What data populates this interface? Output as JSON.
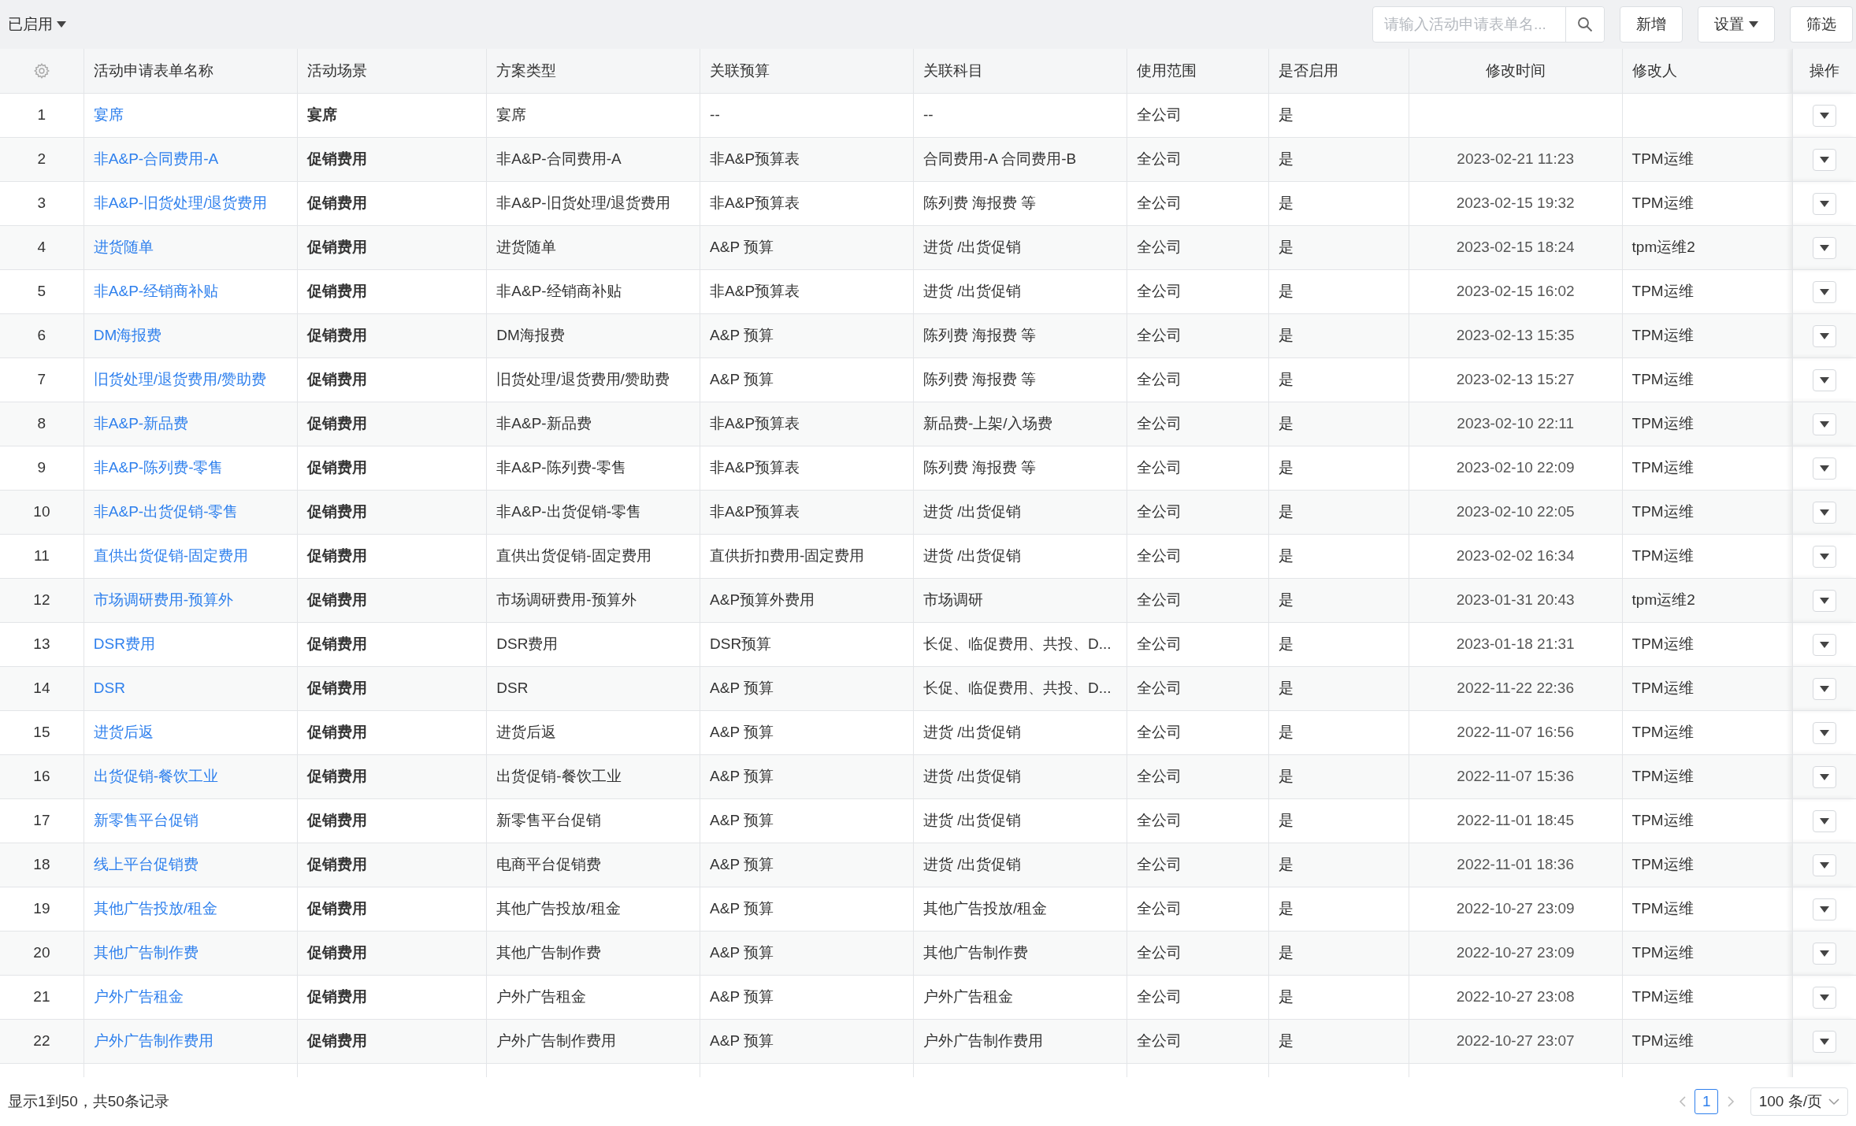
{
  "toolbar": {
    "status_filter": "已启用",
    "search": {
      "placeholder": "请输入活动申请表单名..."
    },
    "buttons": [
      {
        "label": "新增",
        "kind": "plain"
      },
      {
        "label": "设置",
        "kind": "dropdown"
      },
      {
        "label": "筛选",
        "kind": "plain"
      }
    ]
  },
  "table": {
    "columns": [
      "活动申请表单名称",
      "活动场景",
      "方案类型",
      "关联预算",
      "关联科目",
      "使用范围",
      "是否启用",
      "修改时间",
      "修改人",
      "操作"
    ],
    "rows": [
      {
        "index": "1",
        "name": "宴席",
        "scene": "宴席",
        "type": "宴席",
        "budget": "--",
        "subject": "--",
        "scope": "全公司",
        "enabled": "是"
      },
      {
        "index": "2",
        "name": "非A&P-合同费用-A",
        "scene": "促销费用",
        "type": "非A&P-合同费用-A",
        "budget": "非A&P预算表",
        "subject": "合同费用-A 合同费用-B",
        "scope": "全公司",
        "enabled": "是",
        "time": "2023-02-21 11:23",
        "modifier": "TPM运维"
      },
      {
        "index": "3",
        "name": "非A&P-旧货处理/退货费用",
        "scene": "促销费用",
        "type": "非A&P-旧货处理/退货费用",
        "budget": "非A&P预算表",
        "subject": "陈列费 海报费 等",
        "scope": "全公司",
        "enabled": "是",
        "time": "2023-02-15 19:32",
        "modifier": "TPM运维"
      },
      {
        "index": "4",
        "name": "进货随单",
        "scene": "促销费用",
        "type": "进货随单",
        "budget": "A&P 预算",
        "subject": "进货 /出货促销",
        "scope": "全公司",
        "enabled": "是",
        "time": "2023-02-15 18:24",
        "modifier": "tpm运维2"
      },
      {
        "index": "5",
        "name": "非A&P-经销商补贴",
        "scene": "促销费用",
        "type": "非A&P-经销商补贴",
        "budget": "非A&P预算表",
        "subject": "进货 /出货促销",
        "scope": "全公司",
        "enabled": "是",
        "time": "2023-02-15 16:02",
        "modifier": "TPM运维"
      },
      {
        "index": "6",
        "name": "DM海报费",
        "scene": "促销费用",
        "type": "DM海报费",
        "budget": "A&P 预算",
        "subject": "陈列费 海报费 等",
        "scope": "全公司",
        "enabled": "是",
        "time": "2023-02-13 15:35",
        "modifier": "TPM运维"
      },
      {
        "index": "7",
        "name": "旧货处理/退货费用/赞助费",
        "scene": "促销费用",
        "type": "旧货处理/退货费用/赞助费",
        "budget": "A&P 预算",
        "subject": "陈列费 海报费 等",
        "scope": "全公司",
        "enabled": "是",
        "time": "2023-02-13 15:27",
        "modifier": "TPM运维"
      },
      {
        "index": "8",
        "name": "非A&P-新品费",
        "scene": "促销费用",
        "type": "非A&P-新品费",
        "budget": "非A&P预算表",
        "subject": "新品费-上架/入场费",
        "scope": "全公司",
        "enabled": "是",
        "time": "2023-02-10 22:11",
        "modifier": "TPM运维"
      },
      {
        "index": "9",
        "name": "非A&P-陈列费-零售",
        "scene": "促销费用",
        "type": "非A&P-陈列费-零售",
        "budget": "非A&P预算表",
        "subject": "陈列费 海报费 等",
        "scope": "全公司",
        "enabled": "是",
        "time": "2023-02-10 22:09",
        "modifier": "TPM运维"
      },
      {
        "index": "10",
        "name": "非A&P-出货促销-零售",
        "scene": "促销费用",
        "type": "非A&P-出货促销-零售",
        "budget": "非A&P预算表",
        "subject": "进货 /出货促销",
        "scope": "全公司",
        "enabled": "是",
        "time": "2023-02-10 22:05",
        "modifier": "TPM运维"
      },
      {
        "index": "11",
        "name": "直供出货促销-固定费用",
        "scene": "促销费用",
        "type": "直供出货促销-固定费用",
        "budget": "直供折扣费用-固定费用",
        "subject": "进货 /出货促销",
        "scope": "全公司",
        "enabled": "是",
        "time": "2023-02-02 16:34",
        "modifier": "TPM运维"
      },
      {
        "index": "12",
        "name": "市场调研费用-预算外",
        "scene": "促销费用",
        "type": "市场调研费用-预算外",
        "budget": "A&P预算外费用",
        "subject": "市场调研",
        "scope": "全公司",
        "enabled": "是",
        "time": "2023-01-31 20:43",
        "modifier": "tpm运维2"
      },
      {
        "index": "13",
        "name": "DSR费用",
        "scene": "促销费用",
        "type": "DSR费用",
        "budget": "DSR预算",
        "subject": "长促、临促费用、共投、D...",
        "scope": "全公司",
        "enabled": "是",
        "time": "2023-01-18 21:31",
        "modifier": "TPM运维"
      },
      {
        "index": "14",
        "name": "DSR",
        "scene": "促销费用",
        "type": "DSR",
        "budget": "A&P 预算",
        "subject": "长促、临促费用、共投、D...",
        "scope": "全公司",
        "enabled": "是",
        "time": "2022-11-22 22:36",
        "modifier": "TPM运维"
      },
      {
        "index": "15",
        "name": "进货后返",
        "scene": "促销费用",
        "type": "进货后返",
        "budget": "A&P 预算",
        "subject": "进货 /出货促销",
        "scope": "全公司",
        "enabled": "是",
        "time": "2022-11-07 16:56",
        "modifier": "TPM运维"
      },
      {
        "index": "16",
        "name": "出货促销-餐饮工业",
        "scene": "促销费用",
        "type": "出货促销-餐饮工业",
        "budget": "A&P 预算",
        "subject": "进货 /出货促销",
        "scope": "全公司",
        "enabled": "是",
        "time": "2022-11-07 15:36",
        "modifier": "TPM运维"
      },
      {
        "index": "17",
        "name": "新零售平台促销",
        "scene": "促销费用",
        "type": "新零售平台促销",
        "budget": "A&P 预算",
        "subject": "进货 /出货促销",
        "scope": "全公司",
        "enabled": "是",
        "time": "2022-11-01 18:45",
        "modifier": "TPM运维"
      },
      {
        "index": "18",
        "name": "线上平台促销费",
        "scene": "促销费用",
        "type": "电商平台促销费",
        "budget": "A&P 预算",
        "subject": "进货 /出货促销",
        "scope": "全公司",
        "enabled": "是",
        "time": "2022-11-01 18:36",
        "modifier": "TPM运维"
      },
      {
        "index": "19",
        "name": "其他广告投放/租金",
        "scene": "促销费用",
        "type": "其他广告投放/租金",
        "budget": "A&P 预算",
        "subject": "其他广告投放/租金",
        "scope": "全公司",
        "enabled": "是",
        "time": "2022-10-27 23:09",
        "modifier": "TPM运维"
      },
      {
        "index": "20",
        "name": "其他广告制作费",
        "scene": "促销费用",
        "type": "其他广告制作费",
        "budget": "A&P 预算",
        "subject": "其他广告制作费",
        "scope": "全公司",
        "enabled": "是",
        "time": "2022-10-27 23:09",
        "modifier": "TPM运维"
      },
      {
        "index": "21",
        "name": "户外广告租金",
        "scene": "促销费用",
        "type": "户外广告租金",
        "budget": "A&P 预算",
        "subject": "户外广告租金",
        "scope": "全公司",
        "enabled": "是",
        "time": "2022-10-27 23:08",
        "modifier": "TPM运维"
      },
      {
        "index": "22",
        "name": "户外广告制作费用",
        "scene": "促销费用",
        "type": "户外广告制作费用",
        "budget": "A&P 预算",
        "subject": "户外广告制作费用",
        "scope": "全公司",
        "enabled": "是",
        "time": "2022-10-27 23:07",
        "modifier": "TPM运维"
      }
    ]
  },
  "footer": {
    "summary": "显示1到50，共50条记录",
    "pages": [
      {
        "label": "1",
        "selected": true
      }
    ],
    "page_size": "100 条/页"
  }
}
